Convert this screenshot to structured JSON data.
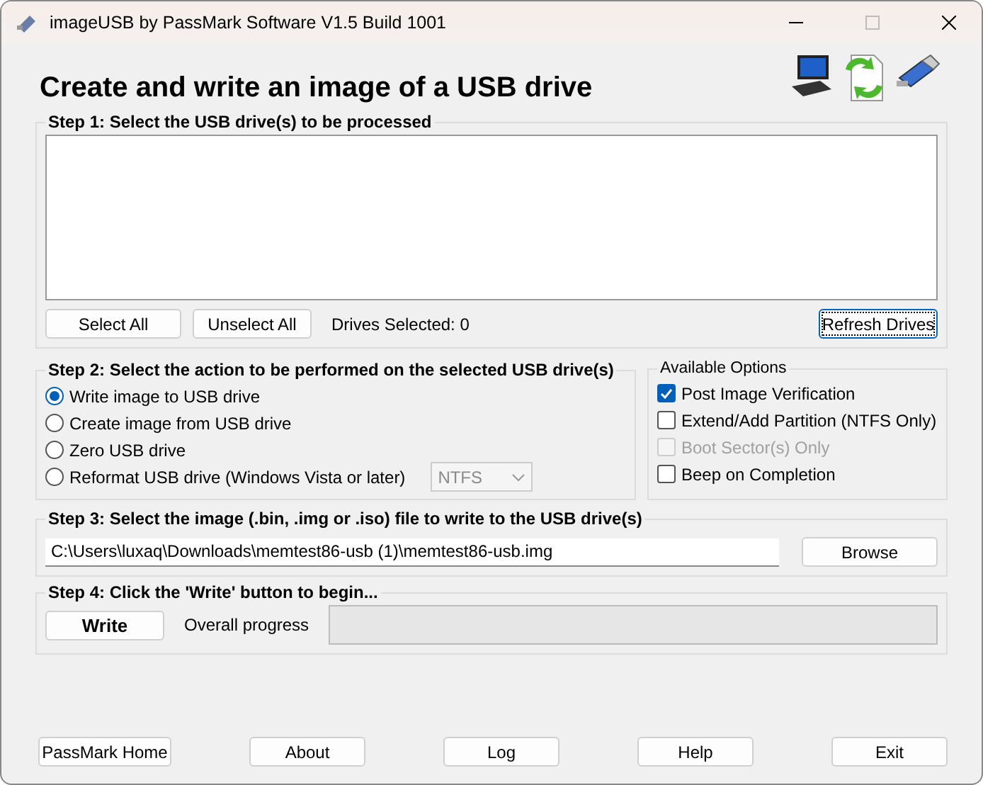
{
  "window": {
    "title": "imageUSB by PassMark Software V1.5 Build 1001"
  },
  "heading": "Create and write an image of a USB drive",
  "step1": {
    "title": "Step 1:  Select the USB drive(s) to be processed",
    "buttons": [
      "Select All",
      "Unselect All"
    ],
    "drives_selected": "Drives Selected: 0",
    "refresh": "Refresh Drives"
  },
  "step2": {
    "title": "Step 2: Select the action to be performed on the selected USB drive(s)",
    "actions": [
      {
        "label": "Write image to USB drive",
        "selected": true
      },
      {
        "label": "Create image from USB drive",
        "selected": false
      },
      {
        "label": "Zero USB drive",
        "selected": false
      },
      {
        "label": "Reformat USB drive (Windows Vista or later)",
        "selected": false
      }
    ],
    "format": {
      "value": "NTFS",
      "disabled": true
    }
  },
  "options": {
    "title": "Available Options",
    "items": [
      {
        "label": "Post Image Verification",
        "checked": true,
        "disabled": false
      },
      {
        "label": "Extend/Add Partition (NTFS Only)",
        "checked": false,
        "disabled": false
      },
      {
        "label": "Boot Sector(s) Only",
        "checked": false,
        "disabled": true
      },
      {
        "label": "Beep on Completion",
        "checked": false,
        "disabled": false
      }
    ]
  },
  "step3": {
    "title": "Step 3: Select the image (.bin, .img or .iso) file to write to the USB drive(s)",
    "path": "C:\\Users\\luxaq\\Downloads\\memtest86-usb (1)\\memtest86-usb.img",
    "browse": "Browse"
  },
  "step4": {
    "title": "Step 4: Click the 'Write' button to begin...",
    "write": "Write",
    "progress_label": "Overall progress",
    "progress": {
      "level": 0
    }
  },
  "footer": [
    "PassMark Home",
    "About",
    "Log",
    "Help",
    "Exit"
  ]
}
